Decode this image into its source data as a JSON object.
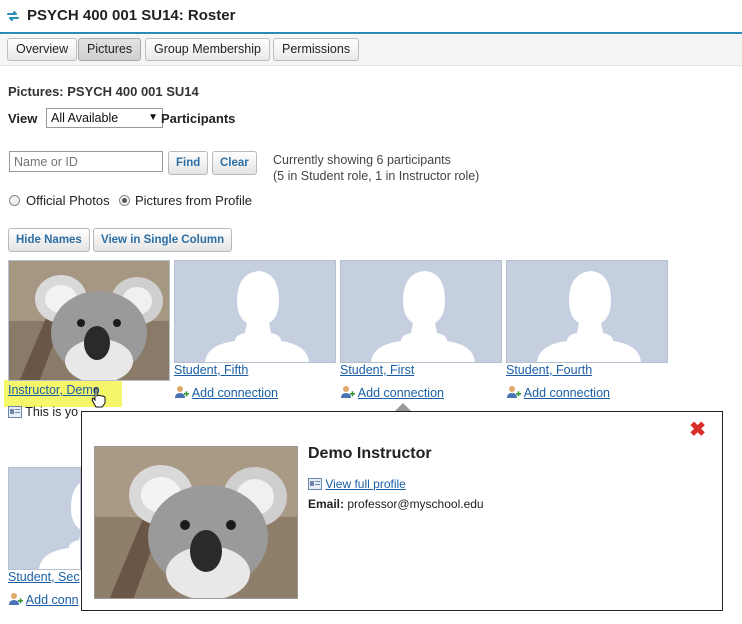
{
  "header": {
    "title": "PSYCH 400 001 SU14: Roster"
  },
  "tabs": [
    {
      "label": "Overview",
      "active": false
    },
    {
      "label": "Pictures",
      "active": true
    },
    {
      "label": "Group Membership",
      "active": false
    },
    {
      "label": "Permissions",
      "active": false
    }
  ],
  "section_title": "Pictures: PSYCH 400 001 SU14",
  "view": {
    "label": "View",
    "selected": "All Available",
    "suffix": "Participants"
  },
  "search": {
    "placeholder": "Name or ID",
    "find_label": "Find",
    "clear_label": "Clear"
  },
  "status": {
    "line1": "Currently showing 6 participants",
    "line2": "(5 in Student role, 1 in Instructor role)"
  },
  "photo_options": {
    "official": "Official Photos",
    "profile": "Pictures from Profile",
    "selected": "profile"
  },
  "buttons": {
    "hide_names": "Hide Names",
    "single_column": "View in Single Column"
  },
  "cards": [
    {
      "name": "Instructor, Demo",
      "note": "This is yo"
    },
    {
      "name": "Student, Fifth",
      "action": "Add connection"
    },
    {
      "name": "Student, First",
      "action": "Add connection"
    },
    {
      "name": "Student, Fourth",
      "action": "Add connection"
    },
    {
      "name": "Student, Sec",
      "action": "Add conn"
    }
  ],
  "popup": {
    "name": "Demo Instructor",
    "profile_link": "View full profile",
    "email_label": "Email:",
    "email": "professor@myschool.edu"
  },
  "colors": {
    "accent": "#2a8bb5",
    "link": "#1a5fa6",
    "highlight": "#f6f66a",
    "close": "#d9302c",
    "placeholder_photo": "#c5cfe0"
  }
}
